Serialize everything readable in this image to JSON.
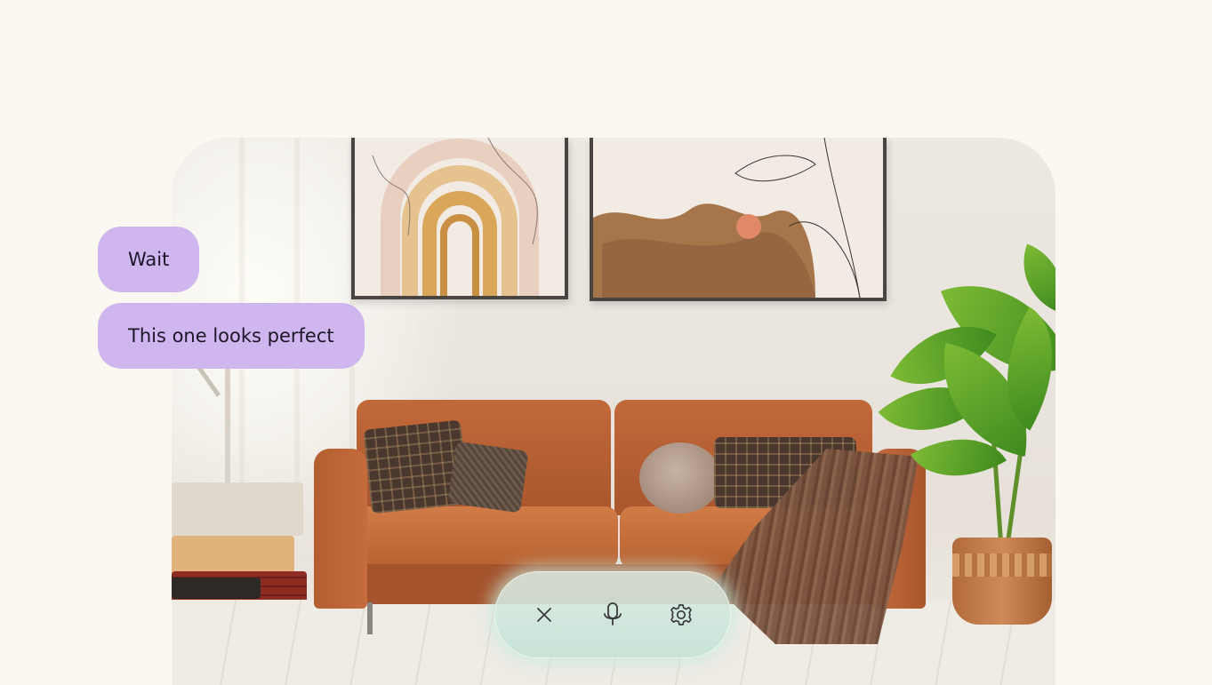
{
  "scene": {
    "description_icon": "camera-view"
  },
  "messages": [
    {
      "text": "Wait"
    },
    {
      "text": "This one looks perfect"
    }
  ],
  "controls": {
    "buttons": [
      {
        "icon": "close-icon"
      },
      {
        "icon": "microphone-icon"
      },
      {
        "icon": "settings-icon"
      }
    ]
  },
  "colors": {
    "page_background": "#fbf7f1",
    "bubble": "#cfb6ef",
    "bubble_text": "#1c1726",
    "control_bar": "#c8e4d8",
    "icon": "#3a3a3a"
  }
}
